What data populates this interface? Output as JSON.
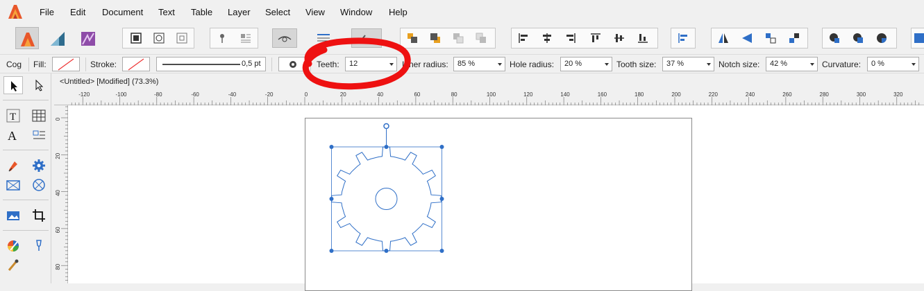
{
  "menu": [
    "File",
    "Edit",
    "Document",
    "Text",
    "Table",
    "Layer",
    "Select",
    "View",
    "Window",
    "Help"
  ],
  "context": {
    "tool_name": "Cog",
    "fill_label": "Fill:",
    "stroke_label": "Stroke:",
    "stroke_width": "0,5 pt",
    "teeth_label": "Teeth:",
    "teeth_value": "12",
    "inner_radius_label": "Inner radius:",
    "inner_radius_value": "85 %",
    "hole_radius_label": "Hole radius:",
    "hole_radius_value": "20 %",
    "tooth_size_label": "Tooth size:",
    "tooth_size_value": "37 %",
    "notch_size_label": "Notch size:",
    "notch_size_value": "42 %",
    "curvature_label": "Curvature:",
    "curvature_value": "0 %"
  },
  "document": {
    "tab_title": "<Untitled> [Modified] (73.3%)",
    "ruler_unit": "mm",
    "h_ticks": [
      "-120",
      "-100",
      "-80",
      "-60",
      "-40",
      "-20",
      "0",
      "20",
      "40",
      "60",
      "80",
      "100",
      "120",
      "140",
      "160",
      "180",
      "200",
      "220",
      "240",
      "260",
      "280",
      "300",
      "320"
    ],
    "v_ticks": [
      "0",
      "20",
      "40",
      "60",
      "80"
    ]
  },
  "colors": {
    "accent_blue": "#2f6fc7",
    "annotation_red": "#ee1111",
    "affinity_orange": "#e8572a"
  },
  "icons": [
    "app-logo-icon",
    "publisher-persona-icon",
    "designer-persona-icon",
    "photo-persona-icon",
    "move-tool-icon",
    "node-tool-icon",
    "text-tool-icon",
    "table-tool-icon",
    "artistic-text-icon",
    "frame-text-icon",
    "pen-tool-icon",
    "cog-tool-icon",
    "picture-frame-icon",
    "ellipse-frame-icon",
    "place-image-icon",
    "crop-tool-icon",
    "color-picker-icon",
    "fill-tool-icon",
    "pencil-tool-icon"
  ]
}
